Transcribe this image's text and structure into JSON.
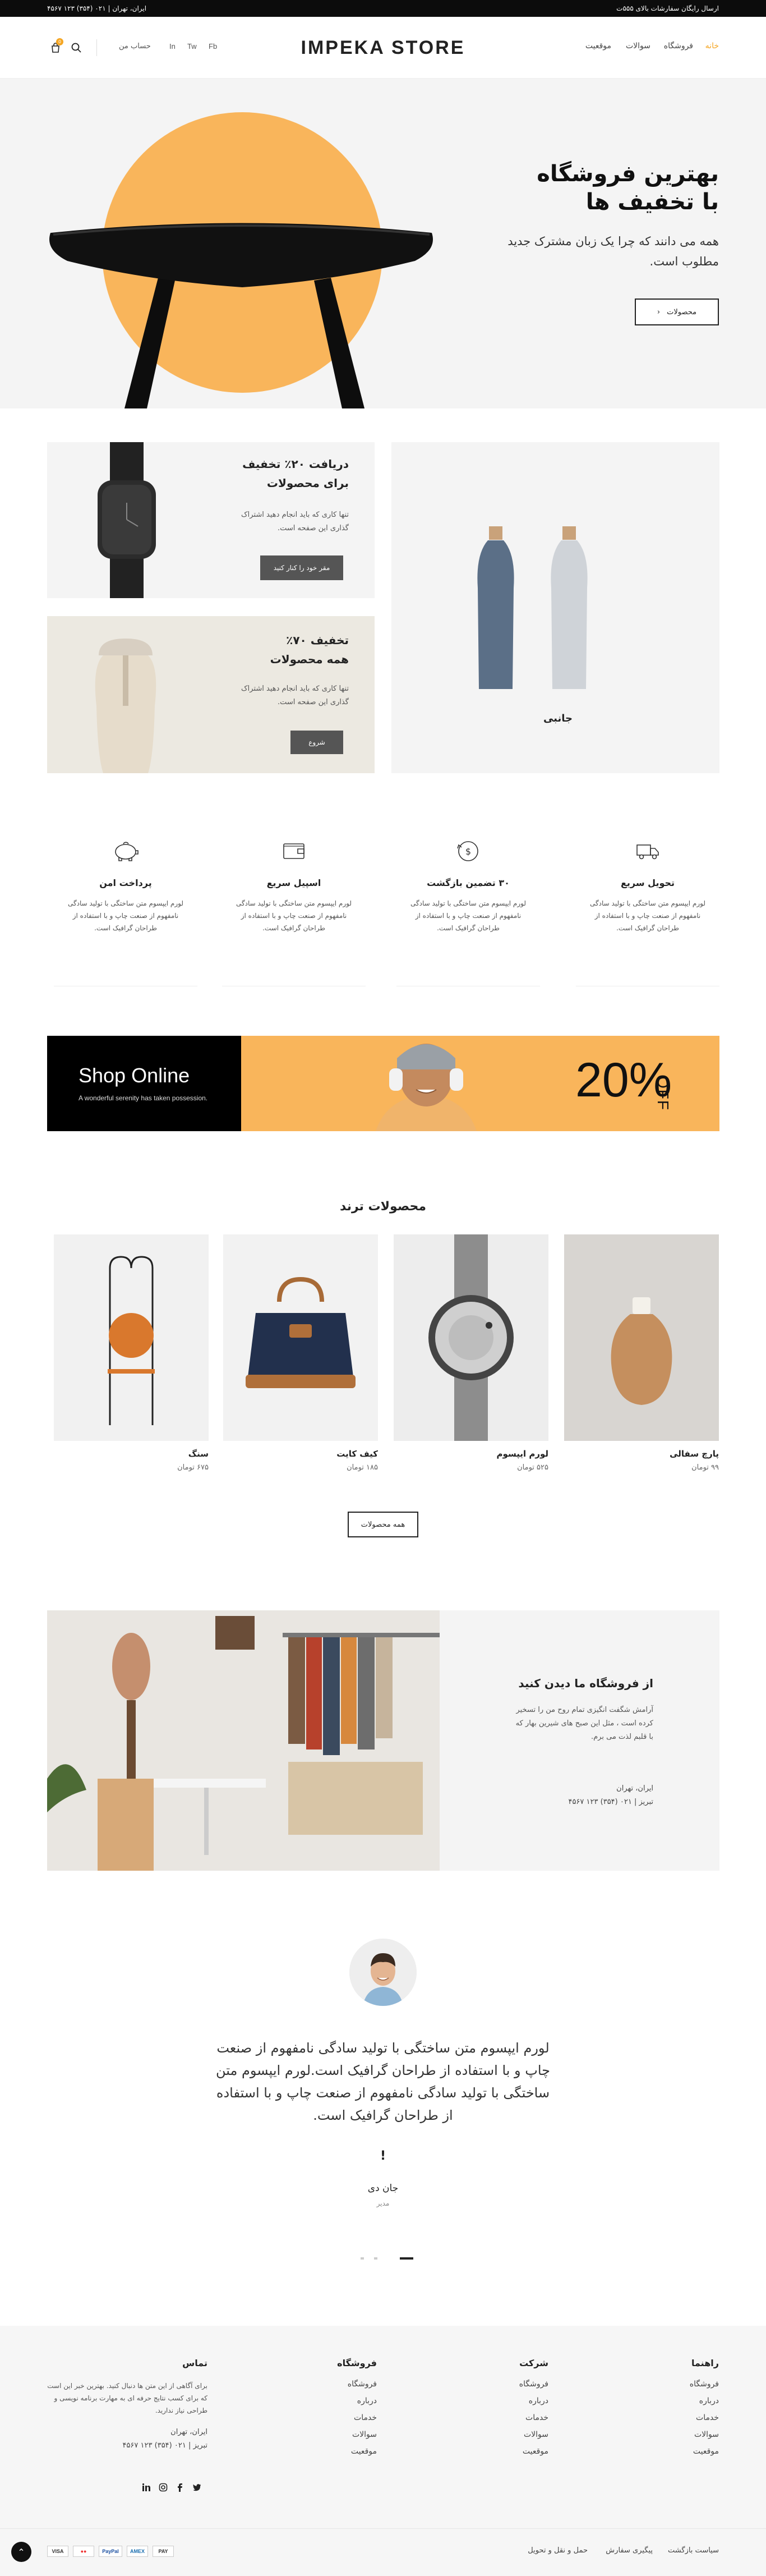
{
  "topbar": {
    "shipping": "ارسال رایگان سفارشات بالای ۵۵۵ت",
    "contact": "ایران، تهران | ۰۲۱ (۳۵۴) ۱۲۳ ۴۵۶۷"
  },
  "header": {
    "logo": "IMPEKA STORE",
    "nav": [
      "خانه",
      "فروشگاه",
      "سوالات",
      "موقعیت"
    ],
    "account": "حساب من",
    "social": [
      "Fb",
      "Tw",
      "In"
    ],
    "cart_count": "0",
    "accent_color": "#f5a623"
  },
  "hero": {
    "title_line1": "بهترین فروشگاه",
    "title_line2": "با تخفیف ها",
    "text": "همه می دانند که چرا یک زبان مشترک جدید مطلوب است.",
    "button": "محصولات"
  },
  "promos": {
    "main": {
      "label": "جانبی"
    },
    "card1": {
      "title_line1": "دریافت ۲۰٪ تخفیف",
      "title_line2": "برای محصولات",
      "text": "تنها کاری که باید انجام دهید اشتراک گذاری این صفحه است.",
      "button": "مقر خود را کنار کنید"
    },
    "card2": {
      "title_line1": "تخفیف ۷۰٪",
      "title_line2": "همه محصولات",
      "text": "تنها کاری که باید انجام دهید اشتراک گذاری این صفحه است.",
      "button": "شروع"
    }
  },
  "features": [
    {
      "icon": "truck-icon",
      "title": "تحویل سریع",
      "text": "لورم ایپسوم متن ساختگی با تولید سادگی نامفهوم از صنعت چاپ و با استفاده از طراحان گرافیک است."
    },
    {
      "icon": "refund-icon",
      "title": "۳۰ تضمین بازگشت",
      "text": "لورم ایپسوم متن ساختگی با تولید سادگی نامفهوم از صنعت چاپ و با استفاده از طراحان گرافیک است."
    },
    {
      "icon": "wallet-icon",
      "title": "اسپیل سریع",
      "text": "لورم ایپسوم متن ساختگی با تولید سادگی نامفهوم از صنعت چاپ و با استفاده از طراحان گرافیک است."
    },
    {
      "icon": "piggy-bank-icon",
      "title": "پرداخت امن",
      "text": "لورم ایپسوم متن ساختگی با تولید سادگی نامفهوم از صنعت چاپ و با استفاده از طراحان گرافیک است."
    }
  ],
  "banner": {
    "title": "Shop Online",
    "subtitle": "A wonderful serenity has taken possession.",
    "discount": "20%",
    "off": "OFF"
  },
  "trending": {
    "title": "محصولات ترند",
    "products": [
      {
        "name": "پارچ سفالی",
        "price": "۹۹ تومان"
      },
      {
        "name": "لورم ایپسوم",
        "price": "۵۲۵ تومان"
      },
      {
        "name": "کیف کایت",
        "price": "۱۸۵ تومان"
      },
      {
        "name": "سنگ",
        "price": "۶۷۵ تومان"
      }
    ],
    "all_button": "همه محصولات"
  },
  "store": {
    "title": "از فروشگاه ما دیدن کنید",
    "text": "آرامش شگفت انگیزی تمام روح من را تسخیر کرده است ، مثل این صبح های شیرین بهار که با قلبم لذت می برم.",
    "address_line1": "ایران، تهران",
    "address_line2": "تبریز | ۰۲۱ (۳۵۴) ۱۲۳ ۴۵۶۷"
  },
  "testimonial": {
    "quote": "لورم ایپسوم متن ساختگی با تولید سادگی نامفهوم از صنعت چاپ و با استفاده از طراحان گرافیک است.لورم ایپسوم متن ساختگی با تولید سادگی نامفهوم از صنعت چاپ و با استفاده از طراحان گرافیک است.",
    "mark": "!",
    "author": "جان دی",
    "role": "مدیر"
  },
  "footer": {
    "guide": {
      "title": "راهنما",
      "links": [
        "فروشگاه",
        "درباره",
        "خدمات",
        "سوالات",
        "موقعیت"
      ]
    },
    "company": {
      "title": "شرکت",
      "links": [
        "فروشگاه",
        "درباره",
        "خدمات",
        "سوالات",
        "موقعیت"
      ]
    },
    "shop": {
      "title": "فروشگاه",
      "links": [
        "فروشگاه",
        "درباره",
        "خدمات",
        "سوالات",
        "موقعیت"
      ]
    },
    "contact": {
      "title": "تماس",
      "text": "برای آگاهی از این متن ها دنبال کنید. بهترین خبر این است که برای کسب نتایج حرفه ای به مهارت برنامه نویسی و طراحی نیاز ندارید.",
      "address_line1": "ایران، تهران",
      "address_line2": "تبریز | ۰۲۱ (۳۵۴) ۱۲۳ ۴۵۶۷"
    },
    "social": [
      "twitter-icon",
      "facebook-icon",
      "instagram-icon",
      "linkedin-icon"
    ],
    "bottom_links": [
      "سیاست بازگشت",
      "پیگیری سفارش",
      "حمل و نقل و تحویل"
    ],
    "payments": [
      "VISA",
      "●●",
      "PayPal",
      "AMEX",
      "PAY"
    ]
  }
}
